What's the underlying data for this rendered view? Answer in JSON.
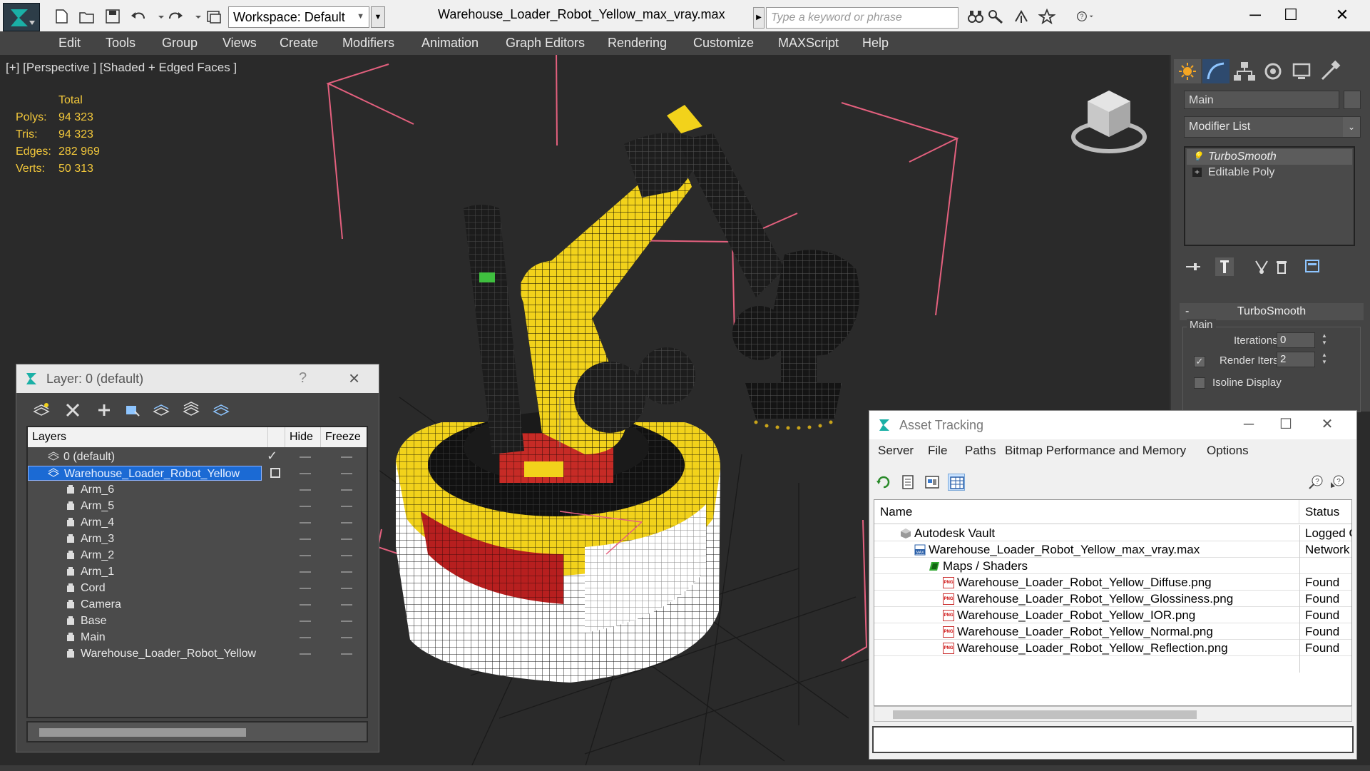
{
  "window": {
    "title": "Warehouse_Loader_Robot_Yellow_max_vray.max",
    "workspace_label": "Workspace: Default",
    "search_placeholder": "Type a keyword or phrase"
  },
  "menu": [
    "Edit",
    "Tools",
    "Group",
    "Views",
    "Create",
    "Modifiers",
    "Animation",
    "Graph Editors",
    "Rendering",
    "Customize",
    "MAXScript",
    "Help"
  ],
  "viewport": {
    "label": "[+] [Perspective ] [Shaded + Edged Faces ]",
    "stats": {
      "header": "Total",
      "rows": [
        {
          "label": "Polys:",
          "value": "94 323"
        },
        {
          "label": "Tris:",
          "value": "94 323"
        },
        {
          "label": "Edges:",
          "value": "282 969"
        },
        {
          "label": "Verts:",
          "value": "50 313"
        }
      ]
    }
  },
  "command_panel": {
    "object_name": "Main",
    "modifier_list_label": "Modifier List",
    "stack": [
      "TurboSmooth",
      "Editable Poly"
    ],
    "turbosmooth": {
      "title": "TurboSmooth",
      "group_label": "Main",
      "iterations_label": "Iterations:",
      "iterations_value": "0",
      "render_iters_label": "Render Iters:",
      "render_iters_value": "2",
      "render_iters_checked": true,
      "isoline_label": "Isoline Display",
      "isoline_checked": false
    }
  },
  "layer_window": {
    "title": "Layer: 0 (default)",
    "help": "?",
    "columns": {
      "layers": "Layers",
      "hide": "Hide",
      "freeze": "Freeze"
    },
    "rows": [
      {
        "name": "0 (default)",
        "level": 1
      },
      {
        "name": "Warehouse_Loader_Robot_Yellow",
        "level": 1
      },
      {
        "name": "Arm_6",
        "level": 2
      },
      {
        "name": "Arm_5",
        "level": 2
      },
      {
        "name": "Arm_4",
        "level": 2
      },
      {
        "name": "Arm_3",
        "level": 2
      },
      {
        "name": "Arm_2",
        "level": 2
      },
      {
        "name": "Arm_1",
        "level": 2
      },
      {
        "name": "Cord",
        "level": 2
      },
      {
        "name": "Camera",
        "level": 2
      },
      {
        "name": "Base",
        "level": 2
      },
      {
        "name": "Main",
        "level": 2
      },
      {
        "name": "Warehouse_Loader_Robot_Yellow",
        "level": 2
      }
    ]
  },
  "asset_window": {
    "title": "Asset Tracking",
    "menu": [
      "Server",
      "File",
      "Paths",
      "Bitmap Performance and Memory",
      "Options"
    ],
    "columns": {
      "name": "Name",
      "status": "Status"
    },
    "rows": [
      {
        "name": "Autodesk Vault",
        "status": "Logged O",
        "icon": "vault"
      },
      {
        "name": "Warehouse_Loader_Robot_Yellow_max_vray.max",
        "status": "Network",
        "icon": "max"
      },
      {
        "name": "Maps / Shaders",
        "status": "",
        "icon": "maps"
      },
      {
        "name": "Warehouse_Loader_Robot_Yellow_Diffuse.png",
        "status": "Found",
        "icon": "png"
      },
      {
        "name": "Warehouse_Loader_Robot_Yellow_Glossiness.png",
        "status": "Found",
        "icon": "png"
      },
      {
        "name": "Warehouse_Loader_Robot_Yellow_IOR.png",
        "status": "Found",
        "icon": "png"
      },
      {
        "name": "Warehouse_Loader_Robot_Yellow_Normal.png",
        "status": "Found",
        "icon": "png"
      },
      {
        "name": "Warehouse_Loader_Robot_Yellow_Reflection.png",
        "status": "Found",
        "icon": "png"
      }
    ]
  },
  "colors": {
    "stats_text": "#f3c83b",
    "selection": "#1b6ad4",
    "robot_yellow": "#f2d21b",
    "bbox_pink": "#e4607e"
  }
}
